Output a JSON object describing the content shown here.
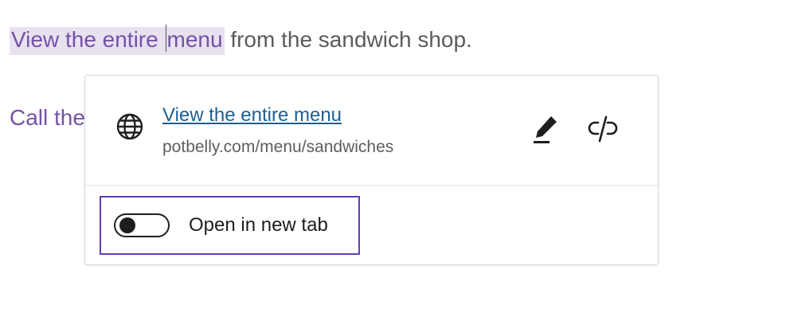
{
  "editor": {
    "paragraph1": {
      "selected_part1": "View the entire ",
      "selected_part2": "menu",
      "rest": " from the sandwich shop."
    },
    "paragraph2": {
      "text": "Call the"
    }
  },
  "link_popover": {
    "icon": "globe-icon",
    "link_title": "View the entire menu",
    "link_url": "potbelly.com/menu/sandwiches",
    "edit_icon": "pencil-icon",
    "unlink_icon": "unlink-icon",
    "open_in_new_tab": {
      "label": "Open in new tab",
      "checked": false
    }
  },
  "colors": {
    "selection_bg": "#e8e1f0",
    "link_text": "#7552a5",
    "popover_link": "#1e5f8f",
    "focus_ring": "#5e3fb5"
  }
}
